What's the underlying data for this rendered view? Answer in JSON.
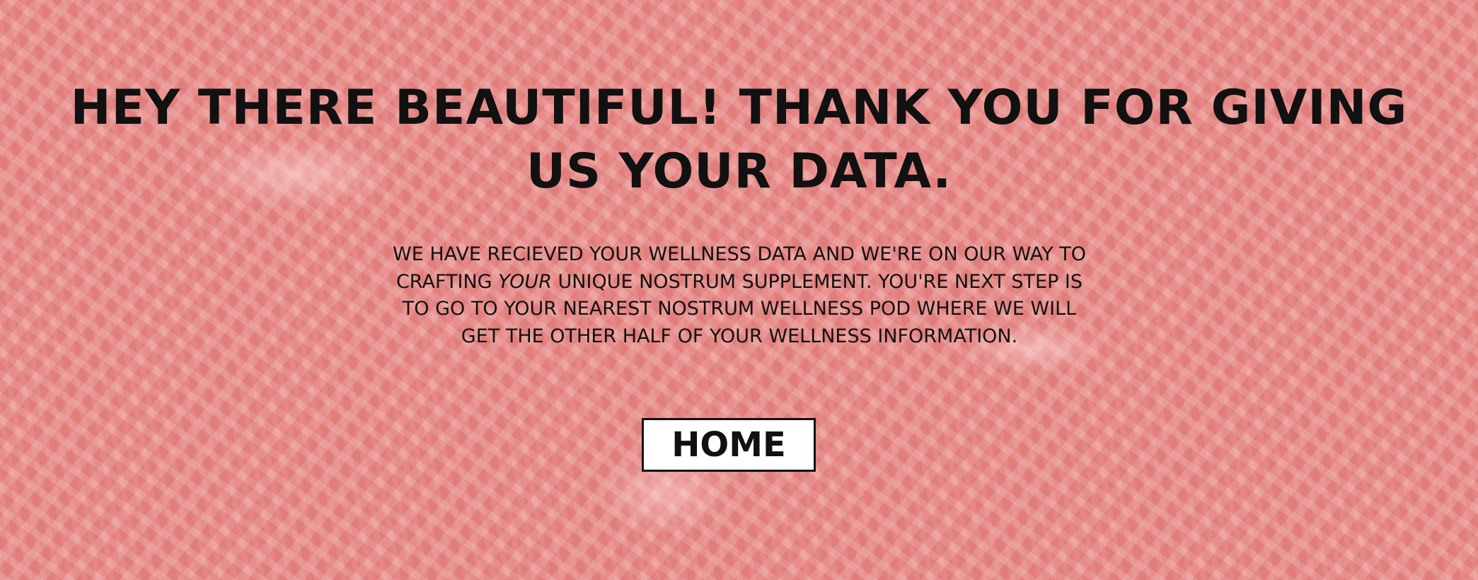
{
  "page": {
    "headline": "HEY THERE BEAUTIFUL! THANK YOU FOR GIVING US YOUR DATA.",
    "message_part1": "WE HAVE RECIEVED YOUR WELLNESS DATA AND WE'RE ON OUR WAY TO CRAFTING ",
    "message_emphasis": "YOUR",
    "message_part2": " UNIQUE NOSTRUM SUPPLEMENT. YOU'RE NEXT STEP IS TO GO TO YOUR NEAREST NOSTRUM WELLNESS POD WHERE WE WILL GET THE OTHER HALF OF YOUR WELLNESS INFORMATION.",
    "home_button_label": "HOME"
  },
  "colors": {
    "background": "#e88a86",
    "text": "#111111",
    "button_background": "#ffffff"
  }
}
